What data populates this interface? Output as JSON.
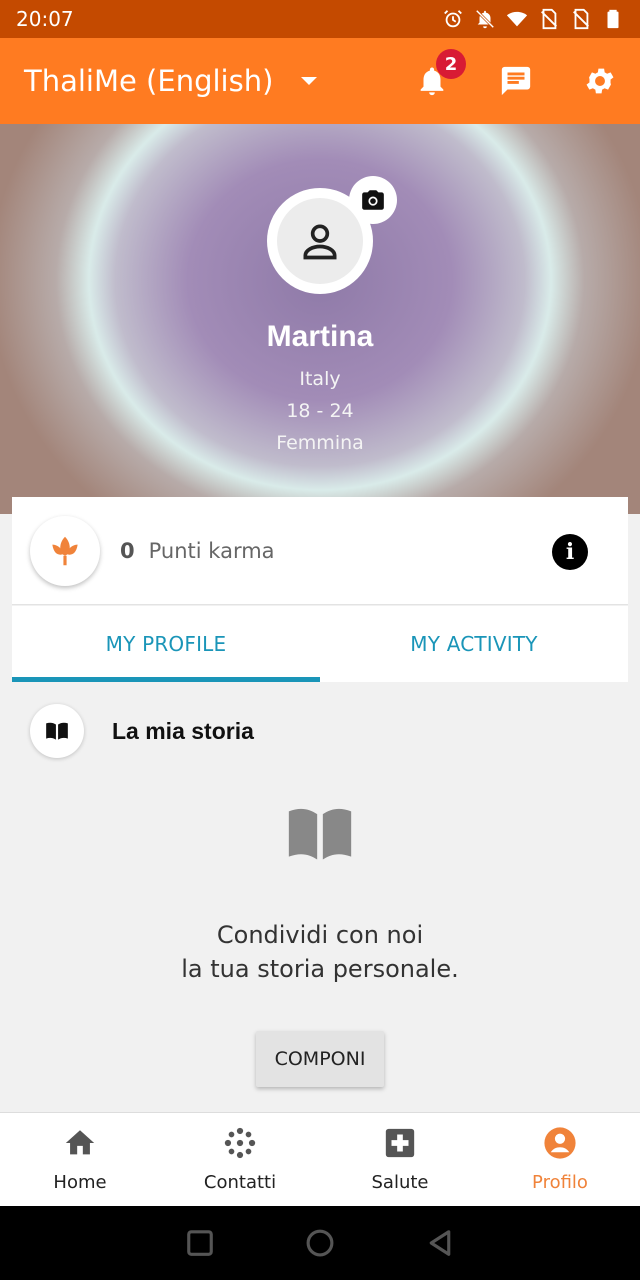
{
  "status_bar": {
    "time": "20:07"
  },
  "app_bar": {
    "title": "ThaliMe (English)",
    "notification_count": "2"
  },
  "profile": {
    "name": "Martina",
    "country": "Italy",
    "age_range": "18 - 24",
    "gender": "Femmina"
  },
  "karma": {
    "points": "0",
    "label": "Punti karma"
  },
  "tabs": [
    {
      "label": "MY PROFILE",
      "active": true
    },
    {
      "label": "MY ACTIVITY",
      "active": false
    }
  ],
  "story": {
    "title": "La mia storia",
    "line1": "Condividi con noi",
    "line2": "la tua storia personale.",
    "button": "COMPONI"
  },
  "bottom_nav": [
    {
      "label": "Home",
      "icon": "home-icon"
    },
    {
      "label": "Contatti",
      "icon": "contacts-icon"
    },
    {
      "label": "Salute",
      "icon": "health-icon"
    },
    {
      "label": "Profilo",
      "icon": "profile-icon",
      "active": true
    }
  ],
  "colors": {
    "primary": "#ff7b21",
    "status_bar": "#c44a00",
    "accent_tab": "#1a95b8",
    "badge": "#d81b34",
    "active_nav": "#f0833a"
  }
}
